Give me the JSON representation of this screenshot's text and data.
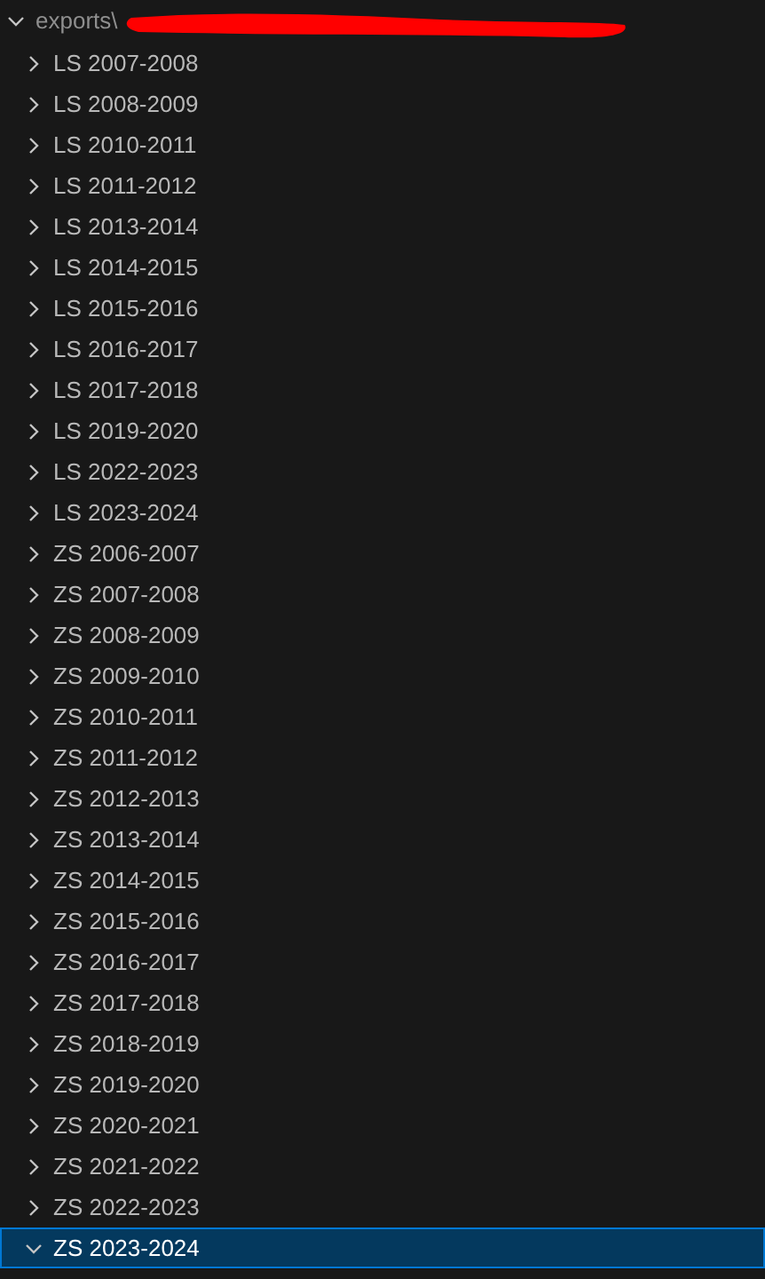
{
  "tree": {
    "label": "exports\\",
    "expanded": true,
    "redacted": true,
    "children": [
      {
        "label": "LS 2007-2008",
        "expanded": false,
        "selected": false
      },
      {
        "label": "LS 2008-2009",
        "expanded": false,
        "selected": false
      },
      {
        "label": "LS 2010-2011",
        "expanded": false,
        "selected": false
      },
      {
        "label": "LS 2011-2012",
        "expanded": false,
        "selected": false
      },
      {
        "label": "LS 2013-2014",
        "expanded": false,
        "selected": false
      },
      {
        "label": "LS 2014-2015",
        "expanded": false,
        "selected": false
      },
      {
        "label": "LS 2015-2016",
        "expanded": false,
        "selected": false
      },
      {
        "label": "LS 2016-2017",
        "expanded": false,
        "selected": false
      },
      {
        "label": "LS 2017-2018",
        "expanded": false,
        "selected": false
      },
      {
        "label": "LS 2019-2020",
        "expanded": false,
        "selected": false
      },
      {
        "label": "LS 2022-2023",
        "expanded": false,
        "selected": false
      },
      {
        "label": "LS 2023-2024",
        "expanded": false,
        "selected": false
      },
      {
        "label": "ZS 2006-2007",
        "expanded": false,
        "selected": false
      },
      {
        "label": "ZS 2007-2008",
        "expanded": false,
        "selected": false
      },
      {
        "label": "ZS 2008-2009",
        "expanded": false,
        "selected": false
      },
      {
        "label": "ZS 2009-2010",
        "expanded": false,
        "selected": false
      },
      {
        "label": "ZS 2010-2011",
        "expanded": false,
        "selected": false
      },
      {
        "label": "ZS 2011-2012",
        "expanded": false,
        "selected": false
      },
      {
        "label": "ZS 2012-2013",
        "expanded": false,
        "selected": false
      },
      {
        "label": "ZS 2013-2014",
        "expanded": false,
        "selected": false
      },
      {
        "label": "ZS 2014-2015",
        "expanded": false,
        "selected": false
      },
      {
        "label": "ZS 2015-2016",
        "expanded": false,
        "selected": false
      },
      {
        "label": "ZS 2016-2017",
        "expanded": false,
        "selected": false
      },
      {
        "label": "ZS 2017-2018",
        "expanded": false,
        "selected": false
      },
      {
        "label": "ZS 2018-2019",
        "expanded": false,
        "selected": false
      },
      {
        "label": "ZS 2019-2020",
        "expanded": false,
        "selected": false
      },
      {
        "label": "ZS 2020-2021",
        "expanded": false,
        "selected": false
      },
      {
        "label": "ZS 2021-2022",
        "expanded": false,
        "selected": false
      },
      {
        "label": "ZS 2022-2023",
        "expanded": false,
        "selected": false
      },
      {
        "label": "ZS 2023-2024",
        "expanded": true,
        "selected": true
      }
    ]
  }
}
